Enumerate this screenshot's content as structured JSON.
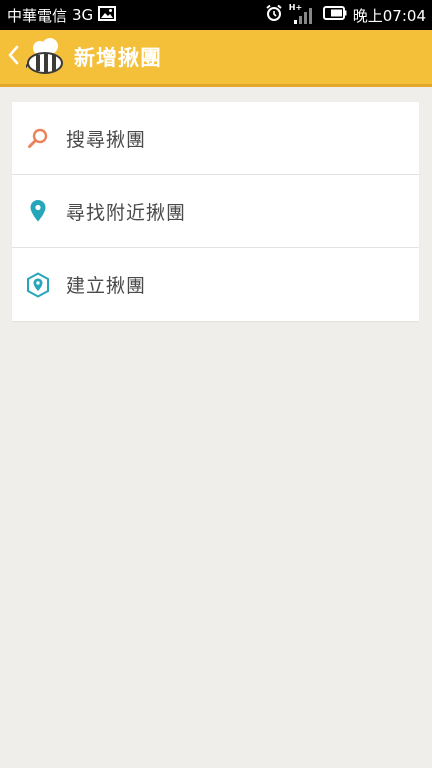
{
  "status_bar": {
    "carrier": "中華電信",
    "network": "3G",
    "signal_label": "H+",
    "time": "晚上07:04",
    "icons": [
      "image-icon",
      "alarm-icon",
      "signal-icon",
      "battery-icon"
    ]
  },
  "app_bar": {
    "title": "新增揪團",
    "icons": [
      "back-chevron-icon",
      "bee-logo-icon"
    ],
    "background": "#f4c03a"
  },
  "menu": {
    "items": [
      {
        "label": "搜尋揪團",
        "icon": "search-icon",
        "icon_color": "#e9835b"
      },
      {
        "label": "尋找附近揪團",
        "icon": "location-pin-icon",
        "icon_color": "#27a6bb"
      },
      {
        "label": "建立揪團",
        "icon": "create-location-icon",
        "icon_color": "#27a6bb"
      }
    ]
  }
}
